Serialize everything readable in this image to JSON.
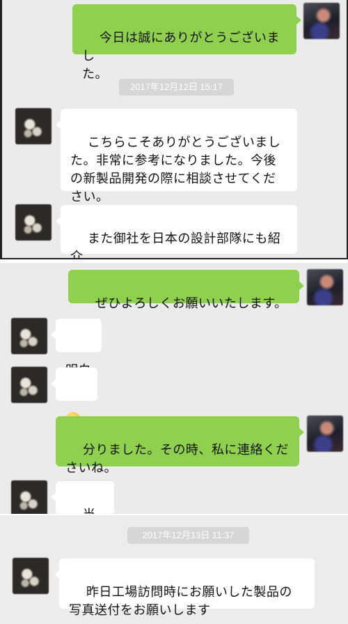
{
  "panels": [
    {
      "messages": [
        {
          "side": "sent",
          "text": "今日は誠にありがとうございまし\nた。"
        },
        {
          "timestamp": "2017年12月12日 15:17"
        },
        {
          "side": "received",
          "text": "こちらこそありがとうございまし\nた。非常に参考になりました。今後\nの新製品開発の際に相談させてくだ\nさい。"
        },
        {
          "side": "received",
          "text": "また御社を日本の設計部隊にも紹介\nしておきます"
        }
      ]
    },
    {
      "messages": [
        {
          "side": "sent",
          "text": "ぜひよろしくお願いいたします。"
        },
        {
          "side": "received",
          "text": "明白"
        },
        {
          "side": "received",
          "emoji": "grinning-face-emoji"
        },
        {
          "side": "sent",
          "text": "分りました。その時、私に連絡くだ\nさいね。"
        },
        {
          "side": "received",
          "text": "当然啊"
        }
      ]
    },
    {
      "messages": [
        {
          "timestamp": "2017年12月13日 11:37"
        },
        {
          "side": "received",
          "text": "昨日工場訪問時にお願いした製品の\n写真送付をお願いします"
        }
      ]
    }
  ],
  "colors": {
    "background": "#ebebeb",
    "sent_bubble": "#8fd14f",
    "received_bubble": "#ffffff",
    "timestamp_bg": "#d6d6d6"
  }
}
